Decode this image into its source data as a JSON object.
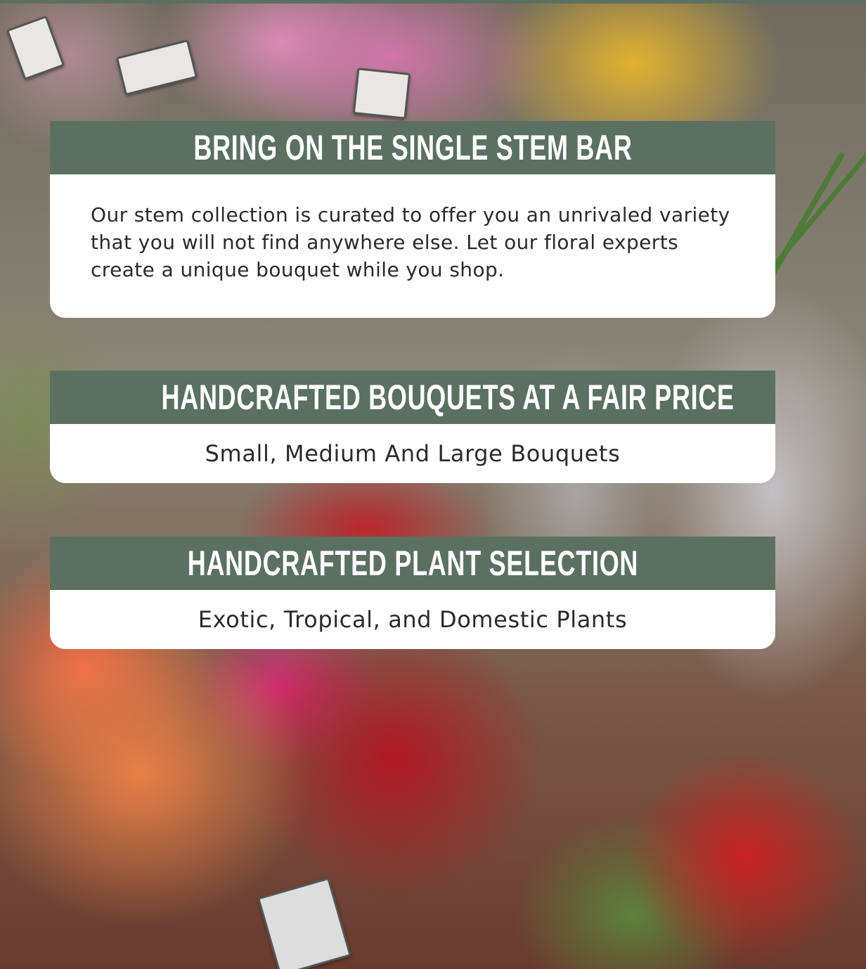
{
  "sections": [
    {
      "title": "BRING ON THE SINGLE STEM BAR",
      "body": "Our stem collection is curated to offer you an unrivaled variety that you will not find anywhere else. Let our floral experts create a unique bouquet while you shop."
    },
    {
      "title": "HANDCRAFTED BOUQUETS AT A FAIR PRICE",
      "body": "Small, Medium And Large Bouquets"
    },
    {
      "title": "HANDCRAFTED PLANT SELECTION",
      "body": "Exotic, Tropical, and Domestic Plants"
    }
  ],
  "colors": {
    "header_green": "#5b7061",
    "card_white": "#ffffff",
    "header_text": "#ffffff",
    "body_text": "#2a2a2a"
  },
  "background": {
    "description_icon": "flower-shop-photo"
  }
}
